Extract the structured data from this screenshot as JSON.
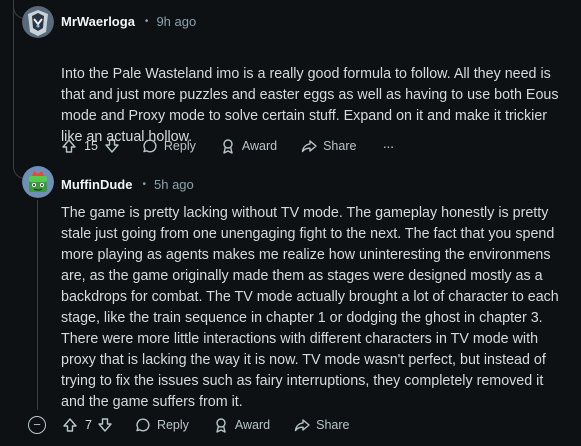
{
  "comments": [
    {
      "username": "MrWaerloga",
      "separator": "•",
      "time": "9h ago",
      "body": "Into the Pale Wasteland imo is a really good formula to follow. All they need is that and just more puzzles and easter eggs as well as having to use both Eous mode and Proxy mode to solve certain stuff. Expand on it and make it trickier like an actual hollow.",
      "votes": "15",
      "reply_label": "Reply",
      "award_label": "Award",
      "share_label": "Share",
      "more_label": "···"
    },
    {
      "username": "MuffinDude",
      "separator": "•",
      "time": "5h ago",
      "body": "The game is pretty lacking without TV mode. The gameplay honestly is pretty stale just going from one unengaging fight to the next. The fact that you spend more playing as agents makes me realize how uninteresting the environmens are, as the game originally made them as stages were designed mostly as a backdrops for combat. The TV mode actually brought a lot of character to each stage, like the train sequence in chapter 1 or dodging the ghost in chapter 3. There were more little interactions with different characters in TV mode with proxy that is lacking the way it is now. TV mode wasn't perfect, but instead of trying to fix the issues such as fairy interruptions, they completely removed it and the game suffers from it.",
      "votes": "7",
      "reply_label": "Reply",
      "award_label": "Award",
      "share_label": "Share",
      "collapse_label": "−"
    }
  ],
  "colors": {
    "background": "#0e1113",
    "text": "#d7dadc",
    "muted": "#8ba2ad",
    "line": "#3a3f42"
  },
  "icons": [
    "upvote-icon",
    "downvote-icon",
    "reply-bubble-icon",
    "award-icon",
    "share-icon",
    "more-icon",
    "collapse-icon"
  ]
}
